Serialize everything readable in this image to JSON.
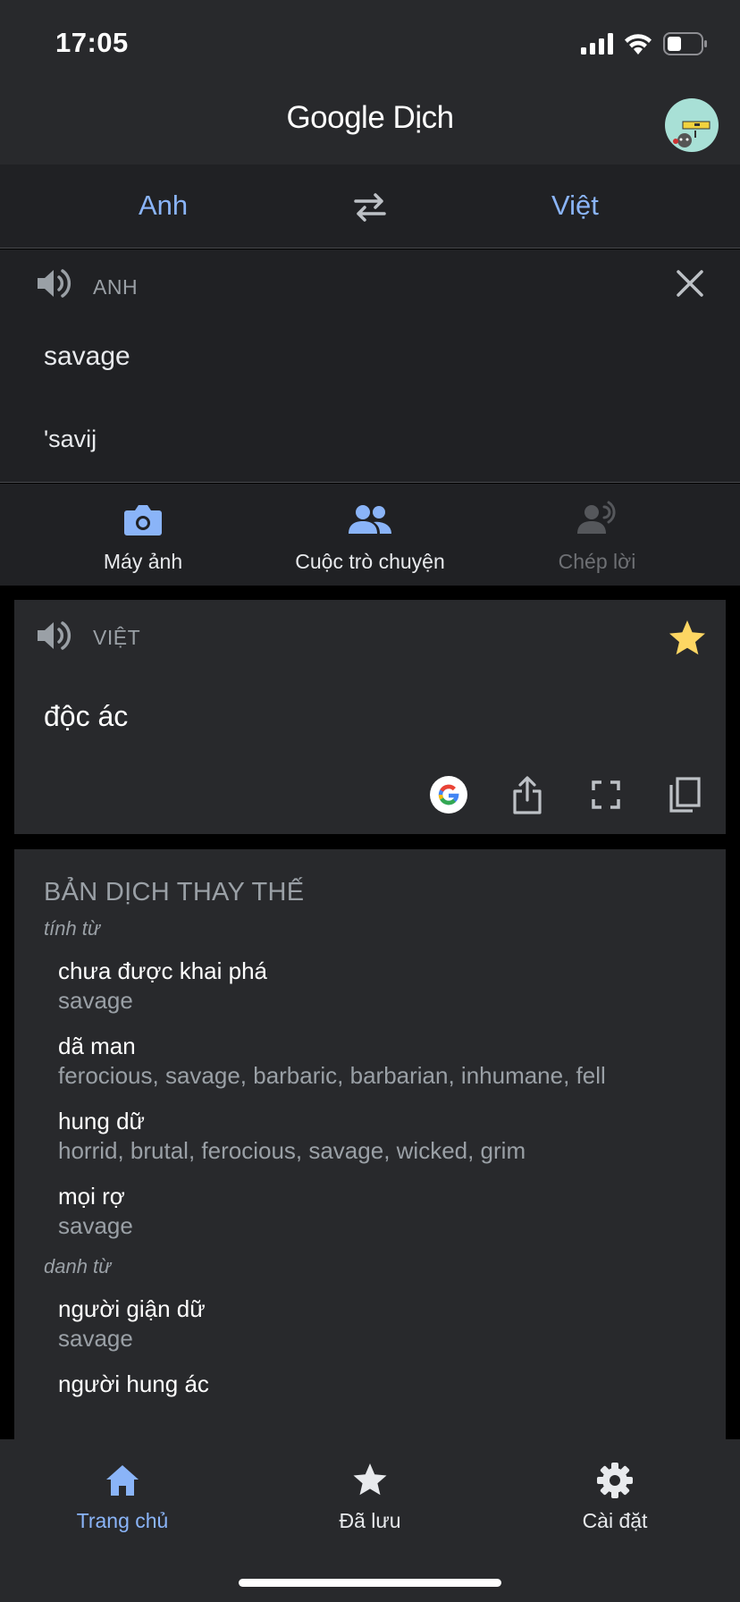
{
  "status_bar": {
    "time": "17:05"
  },
  "header": {
    "title_part1": "Google",
    "title_part2": " Dịch"
  },
  "language_bar": {
    "source": "Anh",
    "target": "Việt"
  },
  "input_card": {
    "language": "ANH",
    "text": "savage",
    "transliteration": "'savij"
  },
  "tools": [
    {
      "label": "Máy ảnh",
      "icon": "camera-icon"
    },
    {
      "label": "Cuộc trò chuyện",
      "icon": "conversation-icon"
    },
    {
      "label": "Chép lời",
      "icon": "transcribe-icon"
    }
  ],
  "result_card": {
    "language": "VIỆT",
    "text": "độc ác"
  },
  "alternatives": {
    "title": "BẢN DỊCH THAY THẾ",
    "groups": [
      {
        "pos": "tính từ",
        "entries": [
          {
            "word": "chưa được khai phá",
            "sources": "savage"
          },
          {
            "word": "dã man",
            "sources": "ferocious, savage, barbaric, barbarian, inhumane, fell"
          },
          {
            "word": "hung dữ",
            "sources": "horrid, brutal, ferocious, savage, wicked, grim"
          },
          {
            "word": "mọi rợ",
            "sources": "savage"
          }
        ]
      },
      {
        "pos": "danh từ",
        "entries": [
          {
            "word": "người giận dữ",
            "sources": "savage"
          },
          {
            "word": "người hung ác",
            "sources": ""
          }
        ]
      }
    ]
  },
  "bottom_nav": [
    {
      "label": "Trang chủ",
      "icon": "home-icon"
    },
    {
      "label": "Đã lưu",
      "icon": "star-icon"
    },
    {
      "label": "Cài đặt",
      "icon": "gear-icon"
    }
  ],
  "colors": {
    "accent": "#8ab4f8",
    "star": "#fdd663",
    "background": "#202124",
    "card": "#28292c"
  }
}
